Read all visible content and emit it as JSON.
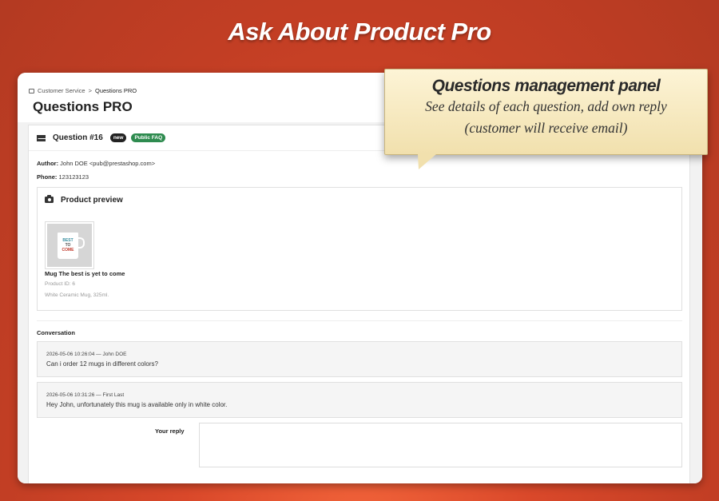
{
  "banner": {
    "title": "Ask About Product Pro"
  },
  "breadcrumb": {
    "parent": "Customer Service",
    "separator": ">",
    "current": "Questions PRO"
  },
  "page": {
    "title": "Questions PRO"
  },
  "question": {
    "title": "Question #16",
    "badges": {
      "new": "new",
      "public": "Public FAQ"
    },
    "author_label": "Author:",
    "author_value": "John DOE <pub@prestashop.com>",
    "phone_label": "Phone:",
    "phone_value": "123123123"
  },
  "preview": {
    "title": "Product preview",
    "product_name": "Mug The best is yet to come",
    "product_id": "Product ID: 6",
    "product_desc": "White Ceramic Mug, 325ml.",
    "mug_text": [
      "BEST",
      "TO",
      "COME"
    ]
  },
  "conversation": {
    "label": "Conversation",
    "messages": [
      {
        "head": "2026-05-06 10:26:04 — John DOE",
        "body": "Can i order 12 mugs in different colors?"
      },
      {
        "head": "2026-05-06 10:31:26 — First Last",
        "body": "Hey John, unfortunately this mug is available only in white color."
      }
    ],
    "reply_label": "Your reply",
    "reply_value": ""
  },
  "callout": {
    "title": "Questions management panel",
    "line1": "See details of each question, add own reply",
    "line2": "(customer will receive email)"
  },
  "colors": {
    "background": "#d9482a",
    "badge_public": "#2e8b4f",
    "badge_new": "#222222",
    "callout": "#f8ebc3"
  }
}
